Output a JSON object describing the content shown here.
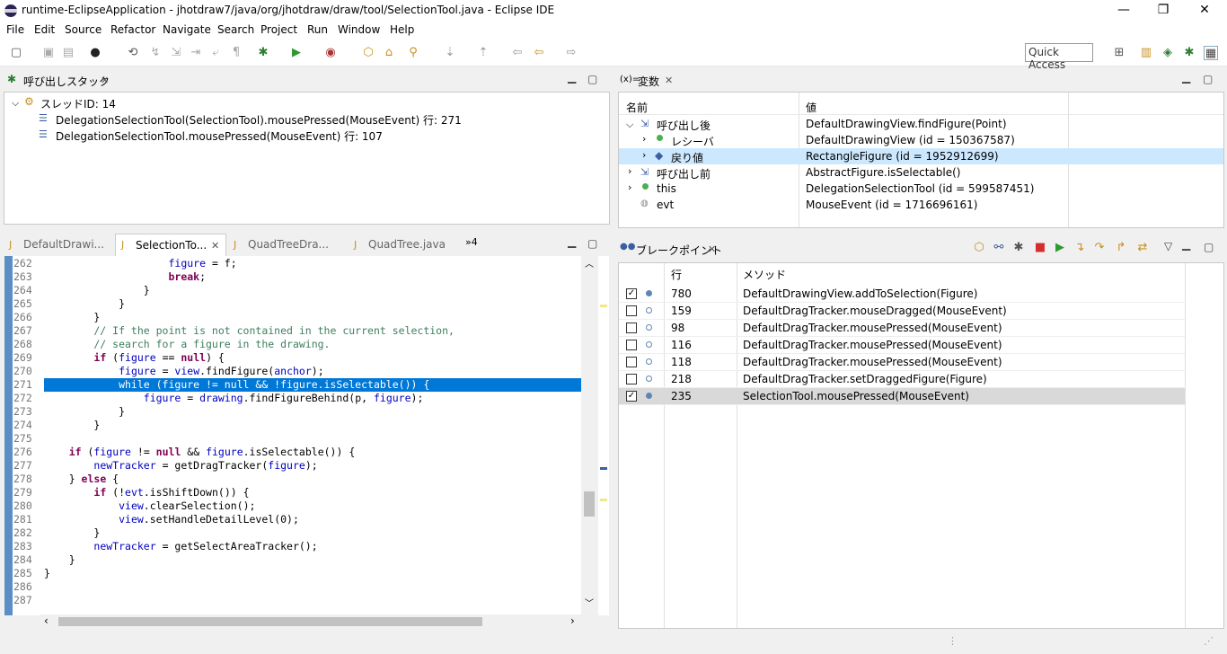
{
  "window": {
    "title": "runtime-EclipseApplication - jhotdraw7/java/org/jhotdraw/draw/tool/SelectionTool.java - Eclipse IDE",
    "minimize": "—",
    "maximize": "❐",
    "close": "✕"
  },
  "menu": [
    "File",
    "Edit",
    "Source",
    "Refactor",
    "Navigate",
    "Search",
    "Project",
    "Run",
    "Window",
    "Help"
  ],
  "quick_access": "Quick Access",
  "callstack": {
    "title": "呼び出しスタック",
    "thread": "スレッドID: 14",
    "frames": [
      "DelegationSelectionTool(SelectionTool).mousePressed(MouseEvent) 行: 271",
      "DelegationSelectionTool.mousePressed(MouseEvent) 行: 107"
    ]
  },
  "variables": {
    "title": "変数",
    "prefix": "(x)=",
    "col_name": "名前",
    "col_value": "値",
    "rows": [
      {
        "name": "呼び出し後",
        "value": "DefaultDrawingView.findFigure(Point)"
      },
      {
        "name": "レシーバ",
        "value": "DefaultDrawingView (id = 150367587)"
      },
      {
        "name": "戻り値",
        "value": "RectangleFigure (id = 1952912699)"
      },
      {
        "name": "呼び出し前",
        "value": "AbstractFigure.isSelectable()"
      },
      {
        "name": "this",
        "value": "DelegationSelectionTool (id = 599587451)"
      },
      {
        "name": "evt",
        "value": "MouseEvent (id = 1716696161)"
      }
    ]
  },
  "editor": {
    "tabs": [
      "DefaultDrawi...",
      "SelectionTo...",
      "QuadTreeDra...",
      "QuadTree.java"
    ],
    "overflow": "»4",
    "lines": [
      {
        "n": "262",
        "t": "                    figure = f;"
      },
      {
        "n": "263",
        "t": "                    break;"
      },
      {
        "n": "264",
        "t": "                }"
      },
      {
        "n": "265",
        "t": "            }"
      },
      {
        "n": "266",
        "t": "        }"
      },
      {
        "n": "267",
        "t": "        // If the point is not contained in the current selection,"
      },
      {
        "n": "268",
        "t": "        // search for a figure in the drawing."
      },
      {
        "n": "269",
        "t": "        if (figure == null) {"
      },
      {
        "n": "270",
        "t": "            figure = view.findFigure(anchor);"
      },
      {
        "n": "271",
        "t": "            while (figure != null && !figure.isSelectable()) {"
      },
      {
        "n": "272",
        "t": "                figure = drawing.findFigureBehind(p, figure);"
      },
      {
        "n": "273",
        "t": "            }"
      },
      {
        "n": "274",
        "t": "        }"
      },
      {
        "n": "275",
        "t": ""
      },
      {
        "n": "276",
        "t": "    if (figure != null && figure.isSelectable()) {"
      },
      {
        "n": "277",
        "t": "        newTracker = getDragTracker(figure);"
      },
      {
        "n": "278",
        "t": "    } else {"
      },
      {
        "n": "279",
        "t": "        if (!evt.isShiftDown()) {"
      },
      {
        "n": "280",
        "t": "            view.clearSelection();"
      },
      {
        "n": "281",
        "t": "            view.setHandleDetailLevel(0);"
      },
      {
        "n": "282",
        "t": "        }"
      },
      {
        "n": "283",
        "t": "        newTracker = getSelectAreaTracker();"
      },
      {
        "n": "284",
        "t": "    }"
      },
      {
        "n": "285",
        "t": "}"
      },
      {
        "n": "286",
        "t": ""
      },
      {
        "n": "287",
        "t": ""
      }
    ]
  },
  "breakpoints": {
    "title": "ブレークポイント",
    "col_line": "行",
    "col_method": "メソッド",
    "rows": [
      {
        "checked": true,
        "line": "780",
        "method": "DefaultDrawingView.addToSelection(Figure)"
      },
      {
        "checked": false,
        "line": "159",
        "method": "DefaultDragTracker.mouseDragged(MouseEvent)"
      },
      {
        "checked": false,
        "line": "98",
        "method": "DefaultDragTracker.mousePressed(MouseEvent)"
      },
      {
        "checked": false,
        "line": "116",
        "method": "DefaultDragTracker.mousePressed(MouseEvent)"
      },
      {
        "checked": false,
        "line": "118",
        "method": "DefaultDragTracker.mousePressed(MouseEvent)"
      },
      {
        "checked": false,
        "line": "218",
        "method": "DefaultDragTracker.setDraggedFigure(Figure)"
      },
      {
        "checked": true,
        "line": "235",
        "method": "SelectionTool.mousePressed(MouseEvent)"
      }
    ]
  }
}
